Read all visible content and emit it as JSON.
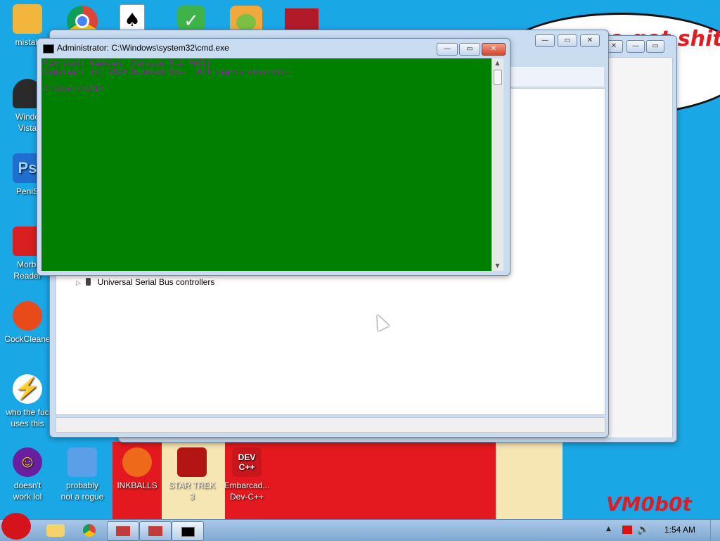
{
  "desktop": {
    "speech_text": "..need to get shit\nnew",
    "watermark": "VM0b0t",
    "icons": [
      {
        "label": "mistak",
        "icon": "folder-user-icon",
        "color": "#f2b63c"
      },
      {
        "label": "Windo\nVista",
        "icon": "recycle-bin-icon",
        "color": "#2a2a2a"
      },
      {
        "label": "PeniS",
        "icon": "photoshop-icon",
        "color": "#1f6fd0"
      },
      {
        "label": "Morbi\nReader",
        "icon": "pdf-reader-icon",
        "color": "#d7201f"
      },
      {
        "label": "CockCleane",
        "icon": "broom-icon",
        "color": "#e84a1a"
      },
      {
        "label": "who the fuc\nuses this",
        "icon": "flash-icon",
        "color": "#e85a14"
      },
      {
        "label": "doesn't\nwork lol",
        "icon": "yahoo-messenger-icon",
        "color": "#6a1fa0"
      },
      {
        "label": "probably\nnot a rogue",
        "icon": "settings-computer-icon",
        "color": "#5aa0e8"
      },
      {
        "label": "INKBALLS",
        "icon": "inkball-icon",
        "color": "#ee6a1a"
      },
      {
        "label": "STAR TREK\n3",
        "icon": "star-wars-game-icon",
        "color": "#b31414"
      },
      {
        "label": "Embarcad...\nDev-C++",
        "icon": "devcpp-icon",
        "color": "#c8161d"
      }
    ],
    "top_icons": [
      "chrome-icon",
      "solitaire-icon",
      "security-shield-icon",
      "angry-birds-icon",
      "winrar-icon"
    ]
  },
  "cmd": {
    "title": "Administrator: C:\\Windows\\system32\\cmd.exe",
    "line1": "Microsoft Windows [Version 6.1.7601]",
    "line2": "Copyright (c) 201X Dilebad Sys.  All rights reserved.",
    "line3": "C:\\Users\\LOL>",
    "minimize": "—",
    "maximize": "▭",
    "close": "✕"
  },
  "device_manager": {
    "tree_item": "Universal Serial Bus controllers"
  },
  "taskbar": {
    "clock": "1:54 AM",
    "buttons": [
      "explorer-icon",
      "chrome-icon",
      "toolbox-icon",
      "toolbox-icon",
      "cmd-icon"
    ]
  }
}
